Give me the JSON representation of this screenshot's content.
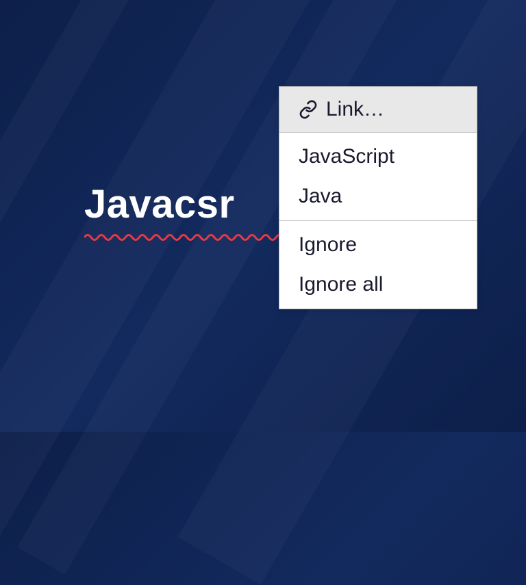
{
  "editor": {
    "misspelled_text": "Javacsr"
  },
  "context_menu": {
    "link_label": "Link…",
    "suggestions": [
      "JavaScript",
      "Java"
    ],
    "ignore_label": "Ignore",
    "ignore_all_label": "Ignore all"
  }
}
